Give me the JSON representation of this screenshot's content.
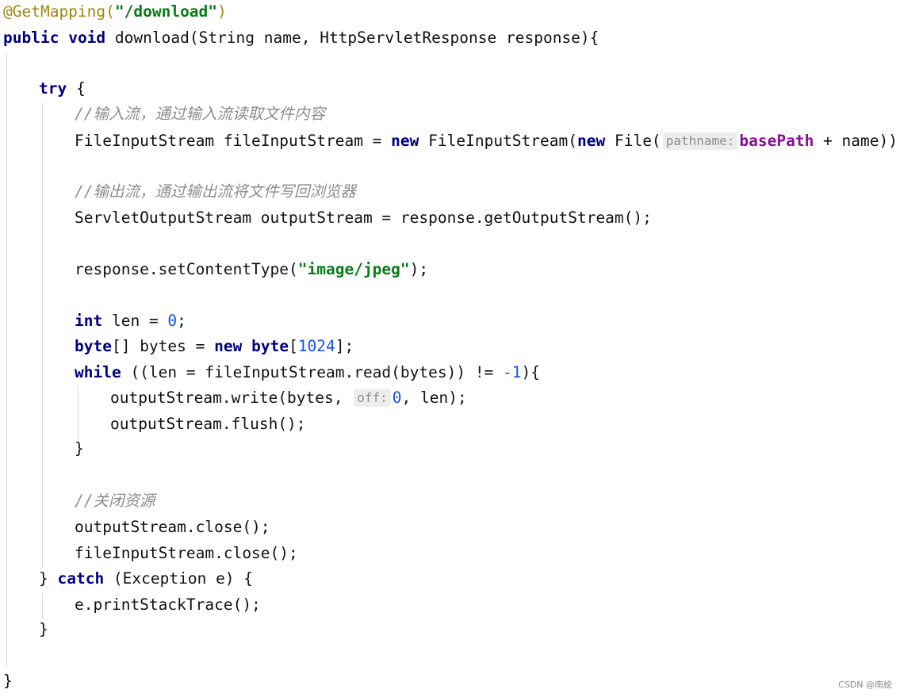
{
  "code": {
    "l01": {
      "annotation": "@GetMapping(",
      "path": "\"/download\"",
      "close": ")"
    },
    "l02": {
      "kw1": "public",
      "kw2": "void",
      "rest": "download(String name, HttpServletResponse response){"
    },
    "l04": {
      "kw": "try",
      "rest": " {"
    },
    "l05": {
      "comment": "//输入流，通过输入流读取文件内容"
    },
    "l06": {
      "pre": "FileInputStream fileInputStream = ",
      "kw1": "new",
      "mid": " FileInputStream(",
      "kw2": "new",
      "mid2": " File(",
      "hint": "pathname:",
      "field": "basePath",
      "post": " + name));"
    },
    "l08": {
      "comment": "//输出流，通过输出流将文件写回浏览器"
    },
    "l09": {
      "text": "ServletOutputStream outputStream = response.getOutputStream();"
    },
    "l11": {
      "pre": "response.setContentType(",
      "str": "\"image/jpeg\"",
      "post": ");"
    },
    "l13": {
      "kw": "int",
      "mid": " len = ",
      "num": "0",
      "post": ";"
    },
    "l14": {
      "kw1": "byte",
      "mid": "[] bytes = ",
      "kw2": "new",
      "kw3": "byte",
      "bracket": "[",
      "num": "1024",
      "post": "];"
    },
    "l15": {
      "kw": "while",
      "pre": " ((len = fileInputStream.read(bytes)) != ",
      "num": "-1",
      "post": "){"
    },
    "l16": {
      "pre": "outputStream.write(bytes, ",
      "hint": "off:",
      "num": "0",
      "post": ", len);"
    },
    "l17": {
      "text": "outputStream.flush();"
    },
    "l18": {
      "text": "}"
    },
    "l20": {
      "comment": "//关闭资源"
    },
    "l21": {
      "text": "outputStream.close();"
    },
    "l22": {
      "text": "fileInputStream.close();"
    },
    "l23": {
      "pre": "} ",
      "kw": "catch",
      "post": " (Exception e) {"
    },
    "l24": {
      "text": "e.printStackTrace();"
    },
    "l25": {
      "text": "}"
    },
    "l27": {
      "text": "}"
    }
  },
  "watermark": "CSDN @南絵",
  "colors": {
    "keyword": "#000080",
    "string": "#067d17",
    "number": "#1750eb",
    "comment": "#8c8c8c",
    "annotation": "#9e880d",
    "field": "#871094",
    "hint_bg": "#ededed"
  }
}
